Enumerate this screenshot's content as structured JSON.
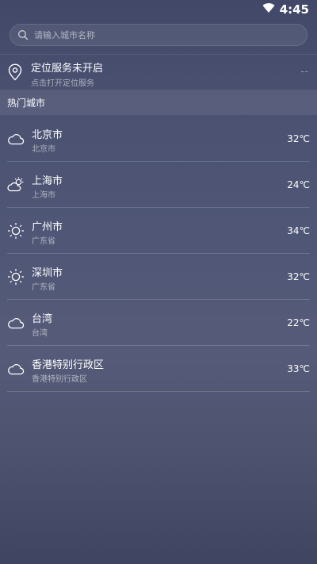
{
  "status_bar": {
    "time": "4:45",
    "wifi_icon": "wifi-icon"
  },
  "search": {
    "placeholder": "请输入城市名称",
    "icon": "search-icon"
  },
  "location": {
    "icon": "location-pin-icon",
    "title": "定位服务未开启",
    "subtitle": "点击打开定位服务",
    "value": "--"
  },
  "section": {
    "title": "热门城市"
  },
  "cities": [
    {
      "name": "北京市",
      "province": "北京市",
      "temp": "32℃",
      "icon": "cloud-icon"
    },
    {
      "name": "上海市",
      "province": "上海市",
      "temp": "24℃",
      "icon": "partly-cloudy-icon"
    },
    {
      "name": "广州市",
      "province": "广东省",
      "temp": "34℃",
      "icon": "sun-icon"
    },
    {
      "name": "深圳市",
      "province": "广东省",
      "temp": "32℃",
      "icon": "sun-icon"
    },
    {
      "name": "台湾",
      "province": "台湾",
      "temp": "22℃",
      "icon": "cloud-icon"
    },
    {
      "name": "香港特别行政区",
      "province": "香港特别行政区",
      "temp": "33℃",
      "icon": "cloud-icon"
    }
  ]
}
